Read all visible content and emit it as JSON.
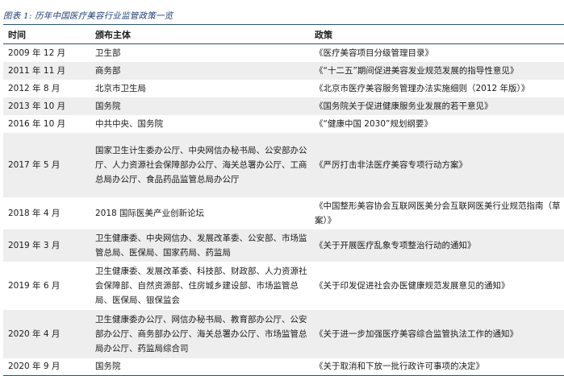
{
  "caption": "图表 1: 历年中国医疗美容行业监管政策一览",
  "table": {
    "headers": [
      "时间",
      "颁布主体",
      "政策"
    ],
    "rows": [
      {
        "time": "2009 年 12 月",
        "subject": "卫生部",
        "policy": "《医疗美容项目分级管理目录》"
      },
      {
        "time": "2011 年 11 月",
        "subject": "商务部",
        "policy": "《“十二五”期间促进美容发业规范发展的指导性意见》"
      },
      {
        "time": "2012 年 8 月",
        "subject": "北京市卫生局",
        "policy": "《北京市医疗美容服务管理办法实施细则（2012 年版）》"
      },
      {
        "time": "2013 年 10 月",
        "subject": "国务院",
        "policy": "《国务院关于促进健康服务业发展的若干意见》"
      },
      {
        "time": "2016 年 10 月",
        "subject": "中共中央、国务院",
        "policy": "《“健康中国 2030”规划纲要》"
      },
      {
        "time": "2017 年 5 月",
        "subject": "国家卫生计生委办公厅、中央网信办秘书局、公安部办公厅、人力资源社会保障部办公厅、海关总署办公厅、工商总局办公厅、食品药品监管总局办公厅",
        "policy": "《严厉打击非法医疗美容专项行动方案》"
      },
      {
        "time": "2018 年 4 月",
        "subject": "2018 国际医美产业创新论坛",
        "policy": "《中国整形美容协会互联网医美分会互联网医美行业规范指南（草案）》"
      },
      {
        "time": "2019 年 3 月",
        "subject": "卫生健康委、中央网信办、发展改革委、公安部、市场监管总局、医保局、国家药局、药监局",
        "policy": "《关于开展医疗乱象专项整治行动的通知》"
      },
      {
        "time": "2019 年 6 月",
        "subject": "卫生健康委、发展改革委、科技部、财政部、人力资源社会保障部、自然资源部、住房城乡建设部、市场监管总局、医保局、银保监会",
        "policy": "《关于印发促进社会办医健康规范发展意见的通知》"
      },
      {
        "time": "2020 年 4 月",
        "subject": "卫生健康委办公厅、网信办秘书局、教育部办公厅、公安部办公厅、商务部办公厅、海关总署办公厅、市场监管总局办公厅、药监局综合司",
        "policy": "《关于进一步加强医疗美容综合监管执法工作的通知》"
      },
      {
        "time": "2020 年 9 月",
        "subject": "国务院",
        "policy": "《关于取消和下放一批行政许可事项的决定》"
      }
    ]
  }
}
